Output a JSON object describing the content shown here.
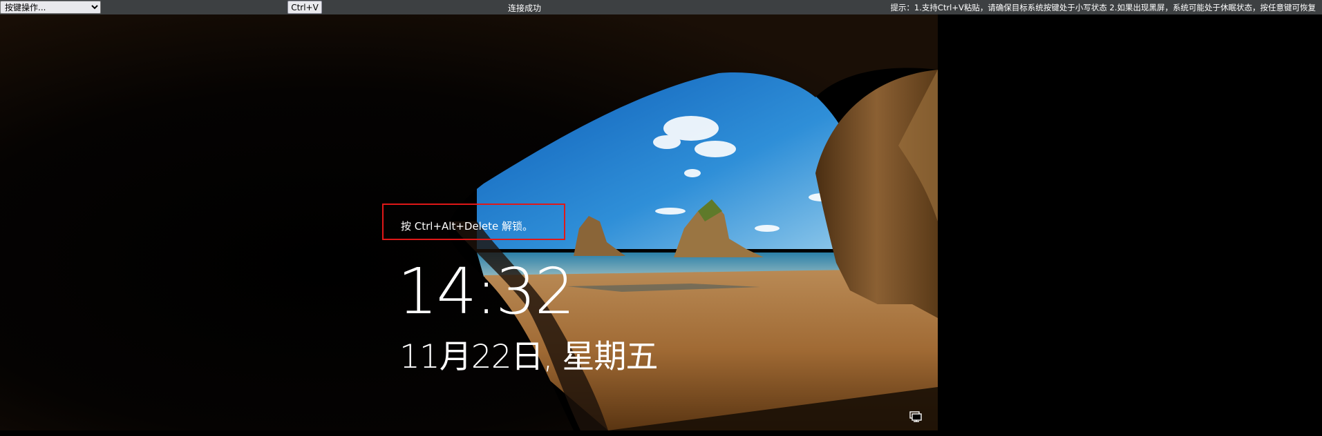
{
  "toolbar": {
    "key_action_select": {
      "selected": "按键操作..."
    },
    "ctrl_v_label": "Ctrl+V",
    "connection_status": "连接成功",
    "hint": "提示：1.支持Ctrl+V粘贴，请确保目标系统按键处于小写状态   2.如果出现黑屏，系统可能处于休眠状态，按任意键可恢复"
  },
  "lock_screen": {
    "unlock_prompt": "按 Ctrl+Alt+Delete 解锁。",
    "time": "14:32",
    "date": "11月22日, 星期五",
    "icons": {
      "network": "network-icon"
    }
  },
  "colors": {
    "toolbar_bg": "#3d4042",
    "highlight_border": "#e01818",
    "text": "#ffffff"
  }
}
